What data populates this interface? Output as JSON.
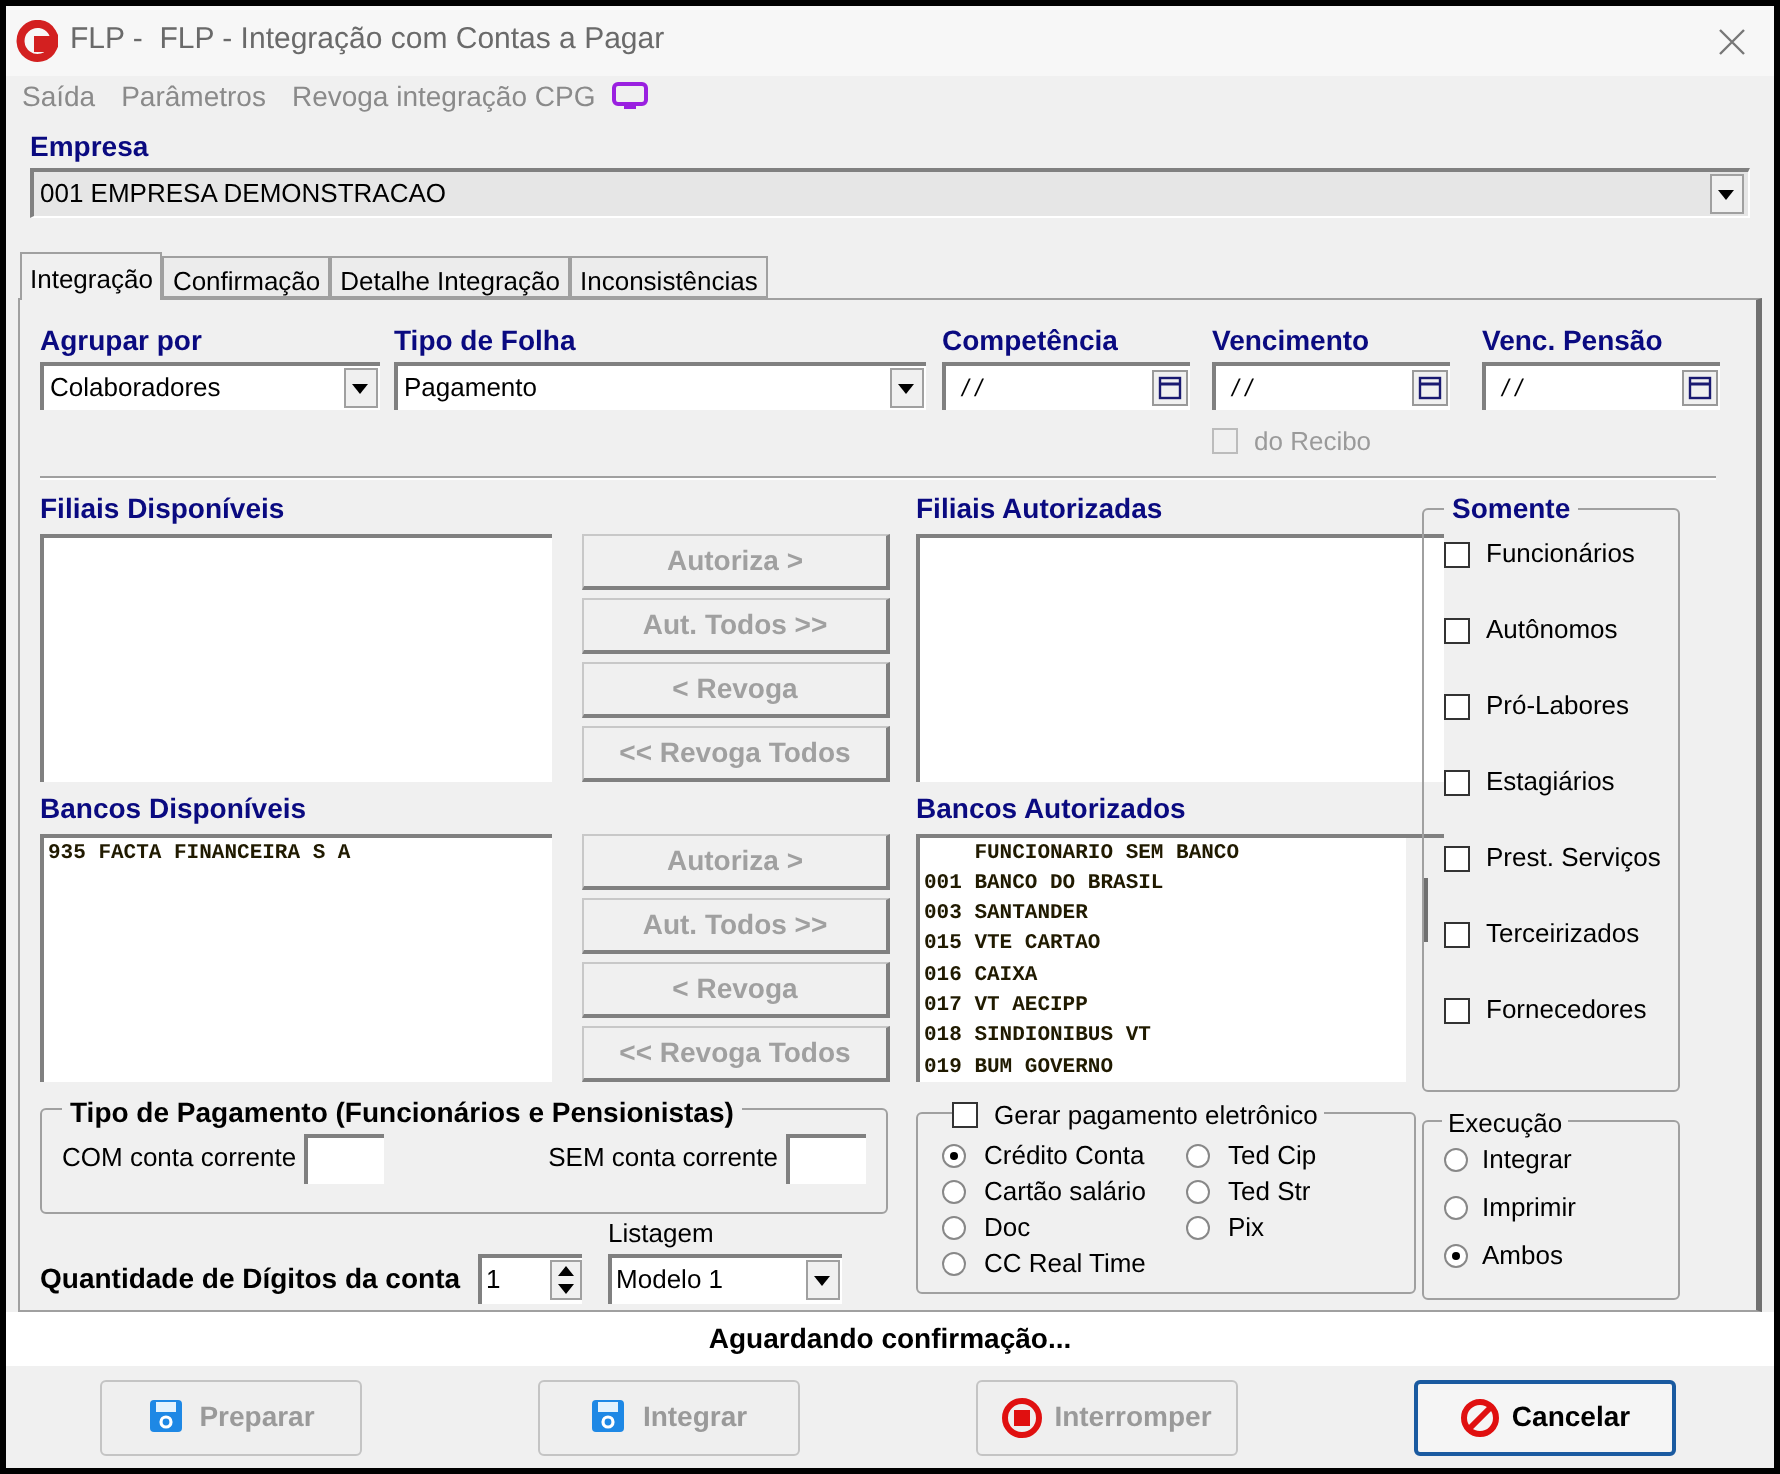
{
  "window": {
    "title": "FLP -  FLP - Integração com Contas a Pagar"
  },
  "menu": [
    {
      "label": "Saída"
    },
    {
      "label": "Parâmetros"
    },
    {
      "label": "Revoga integração CPG"
    }
  ],
  "empresa": {
    "label": "Empresa",
    "value": "001 EMPRESA DEMONSTRACAO"
  },
  "tabs": [
    {
      "label": "Integração",
      "selected": true
    },
    {
      "label": "Confirmação",
      "selected": false
    },
    {
      "label": "Detalhe Integração",
      "selected": false
    },
    {
      "label": "Inconsistências",
      "selected": false
    }
  ],
  "fields": [
    {
      "kind": "combo",
      "label": "Agrupar por",
      "value": "Colaboradores"
    },
    {
      "kind": "combo",
      "label": "Tipo de Folha",
      "value": "Pagamento"
    },
    {
      "kind": "date",
      "label": "Competência",
      "value": "/ /"
    },
    {
      "kind": "date",
      "label": "Vencimento",
      "value": "/ /"
    },
    {
      "kind": "date",
      "label": "Venc. Pensão",
      "value": "/ /"
    }
  ],
  "do_recibo": {
    "label": "do Recibo",
    "checked": false,
    "disabled": true
  },
  "filiais": {
    "available_label": "Filiais Disponíveis",
    "authorized_label": "Filiais Autorizadas",
    "buttons": [
      {
        "label": "Autoriza >",
        "disabled": true
      },
      {
        "label": "Aut. Todos >>",
        "disabled": true
      },
      {
        "label": "< Revoga",
        "disabled": true
      },
      {
        "label": "<< Revoga Todos",
        "disabled": true
      }
    ]
  },
  "bancos": {
    "available_label": "Bancos Disponíveis",
    "available_items": [
      "935 FACTA FINANCEIRA S A"
    ],
    "authorized_label": "Bancos Autorizados",
    "authorized_items": [
      "    FUNCIONARIO SEM BANCO",
      "001 BANCO DO BRASIL",
      "003 SANTANDER",
      "015 VTE CARTAO",
      "016 CAIXA",
      "017 VT AECIPP",
      "018 SINDIONIBUS VT",
      "019 BUM GOVERNO"
    ],
    "buttons": [
      {
        "label": "Autoriza >",
        "disabled": true
      },
      {
        "label": "Aut. Todos >>",
        "disabled": true
      },
      {
        "label": "< Revoga",
        "disabled": true
      },
      {
        "label": "<< Revoga Todos",
        "disabled": true
      }
    ]
  },
  "somente": {
    "title": "Somente",
    "options": [
      {
        "label": "Funcionários",
        "checked": false
      },
      {
        "label": "Autônomos",
        "checked": false
      },
      {
        "label": "Pró-Labores",
        "checked": false
      },
      {
        "label": "Estagiários",
        "checked": false
      },
      {
        "label": "Prest. Serviços",
        "checked": false
      },
      {
        "label": "Terceirizados",
        "checked": false
      },
      {
        "label": "Fornecedores",
        "checked": false
      }
    ]
  },
  "tipo_pagamento": {
    "title": "Tipo de Pagamento (Funcionários e Pensionistas)",
    "fields": [
      {
        "label": "COM conta corrente"
      },
      {
        "label": "SEM conta corrente"
      }
    ]
  },
  "quantidade": {
    "label": "Quantidade de Dígitos da conta",
    "value": "1"
  },
  "listagem": {
    "label": "Listagem",
    "value": "Modelo 1"
  },
  "pagamento_eletronico": {
    "label": "Gerar pagamento eletrônico",
    "checked": false,
    "options": [
      {
        "label": "Crédito Conta",
        "selected": true
      },
      {
        "label": "Cartão salário",
        "selected": false
      },
      {
        "label": "Doc",
        "selected": false
      },
      {
        "label": "CC Real Time",
        "selected": false
      },
      {
        "label": "Ted Cip",
        "selected": false
      },
      {
        "label": "Ted Str",
        "selected": false
      },
      {
        "label": "Pix",
        "selected": false
      }
    ]
  },
  "execucao": {
    "title": "Execução",
    "options": [
      {
        "label": "Integrar",
        "selected": false
      },
      {
        "label": "Imprimir",
        "selected": false
      },
      {
        "label": "Ambos",
        "selected": true
      }
    ]
  },
  "status_bar": {
    "text": "Aguardando confirmação..."
  },
  "buttons": [
    {
      "kind": "floppy",
      "label": "Preparar",
      "disabled": true,
      "focused": false
    },
    {
      "kind": "floppy",
      "label": "Integrar",
      "disabled": true,
      "focused": false
    },
    {
      "kind": "stop",
      "label": "Interromper",
      "disabled": true,
      "focused": false
    },
    {
      "kind": "cancel",
      "label": "Cancelar",
      "disabled": false,
      "focused": true
    }
  ]
}
